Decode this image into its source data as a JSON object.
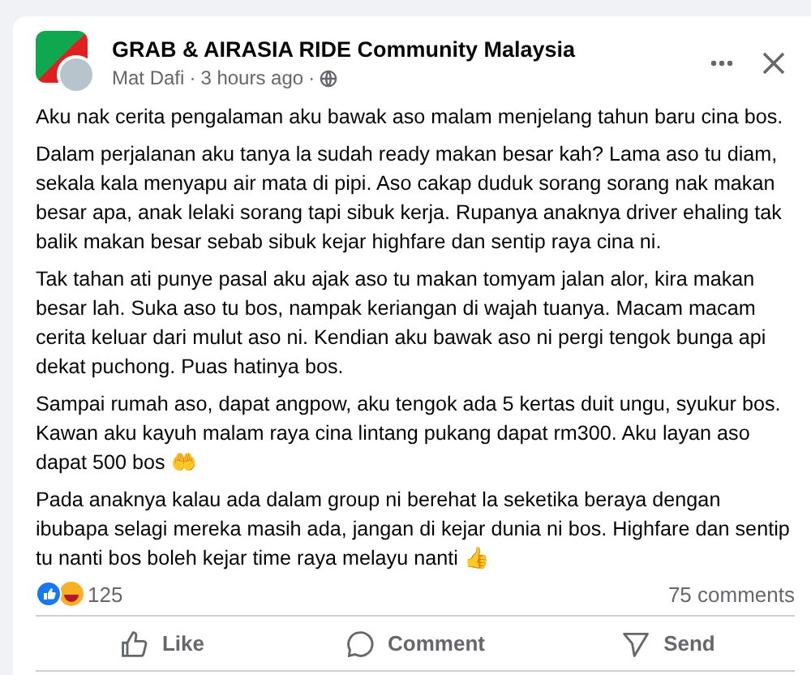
{
  "post": {
    "group": "GRAB & AIRASIA RIDE Community Malaysia",
    "author": "Mat Dafi",
    "separator": "·",
    "time": "3 hours ago",
    "paragraphs": [
      "Aku nak cerita pengalaman aku bawak aso malam menjelang tahun baru cina bos.",
      "Dalam perjalanan aku tanya la sudah ready makan besar kah? Lama aso tu diam, sekala kala menyapu air mata di pipi. Aso cakap duduk sorang sorang nak makan besar apa, anak lelaki sorang tapi sibuk kerja. Rupanya anaknya driver ehaling tak balik makan besar sebab sibuk kejar highfare dan sentip raya cina ni.",
      "Tak tahan ati punye pasal aku ajak aso tu makan tomyam jalan alor, kira makan besar lah. Suka aso tu bos, nampak keriangan di wajah tuanya. Macam macam cerita keluar dari mulut aso ni. Kendian aku bawak aso ni pergi tengok bunga api dekat puchong. Puas hatinya bos.",
      "Sampai rumah aso, dapat angpow, aku tengok ada 5 kertas duit ungu, syukur bos. Kawan aku kayuh malam raya cina lintang pukang dapat rm300. Aku layan aso dapat 500 bos 🤲",
      "Pada anaknya kalau ada dalam group ni berehat la seketika beraya dengan ibubapa selagi mereka masih ada, jangan di kejar dunia ni bos. Highfare dan sentip tu nanti bos boleh kejar time raya melayu nanti 👍"
    ],
    "reaction_count": "125",
    "comments_count": "75 comments",
    "actions": [
      {
        "kind": "like",
        "label": "Like"
      },
      {
        "kind": "comment",
        "label": "Comment"
      },
      {
        "kind": "send",
        "label": "Send"
      }
    ]
  }
}
